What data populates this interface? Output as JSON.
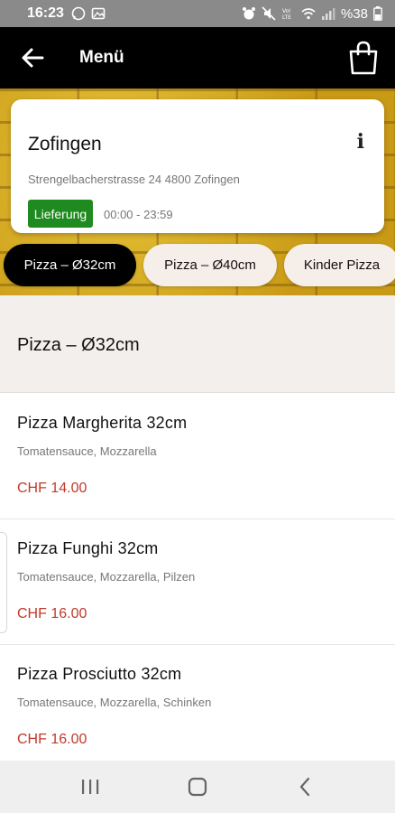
{
  "status_bar": {
    "time": "16:23",
    "battery": "%38",
    "icons": [
      "whatsapp-icon",
      "gallery-icon",
      "alarm-icon",
      "mute-icon",
      "volte-icon",
      "wifi-icon",
      "signal-icon",
      "battery-icon"
    ]
  },
  "app_bar": {
    "title": "Menü",
    "back_icon": "arrow-left-icon",
    "cart_icon": "shopping-bag-icon"
  },
  "store": {
    "name": "Zofingen",
    "address": "Strengelbacherstrasse 24 4800 Zofingen",
    "badge": "Lieferung",
    "hours": "00:00 - 23:59",
    "info_icon": "info-icon",
    "badge_color": "#1f8a1f"
  },
  "tabs": [
    {
      "label": "Pizza – Ø32cm",
      "active": true
    },
    {
      "label": "Pizza – Ø40cm",
      "active": false
    },
    {
      "label": "Kinder Pizza",
      "active": false
    }
  ],
  "section": {
    "title": "Pizza – Ø32cm"
  },
  "products": [
    {
      "name": "Pizza Margherita 32cm",
      "description": "Tomatensauce, Mozzarella",
      "price": "CHF 14.00"
    },
    {
      "name": "Pizza Funghi 32cm",
      "description": "Tomatensauce, Mozzarella, Pilzen",
      "price": "CHF 16.00"
    },
    {
      "name": "Pizza Prosciutto 32cm",
      "description": "Tomatensauce, Mozzarella, Schinken",
      "price": "CHF 16.00"
    }
  ],
  "nav_bar": {
    "recents_icon": "recents-icon",
    "home_icon": "home-icon",
    "back_icon": "nav-back-icon"
  },
  "colors": {
    "price": "#c0392b",
    "header": "#000000",
    "active_tab": "#000000"
  }
}
